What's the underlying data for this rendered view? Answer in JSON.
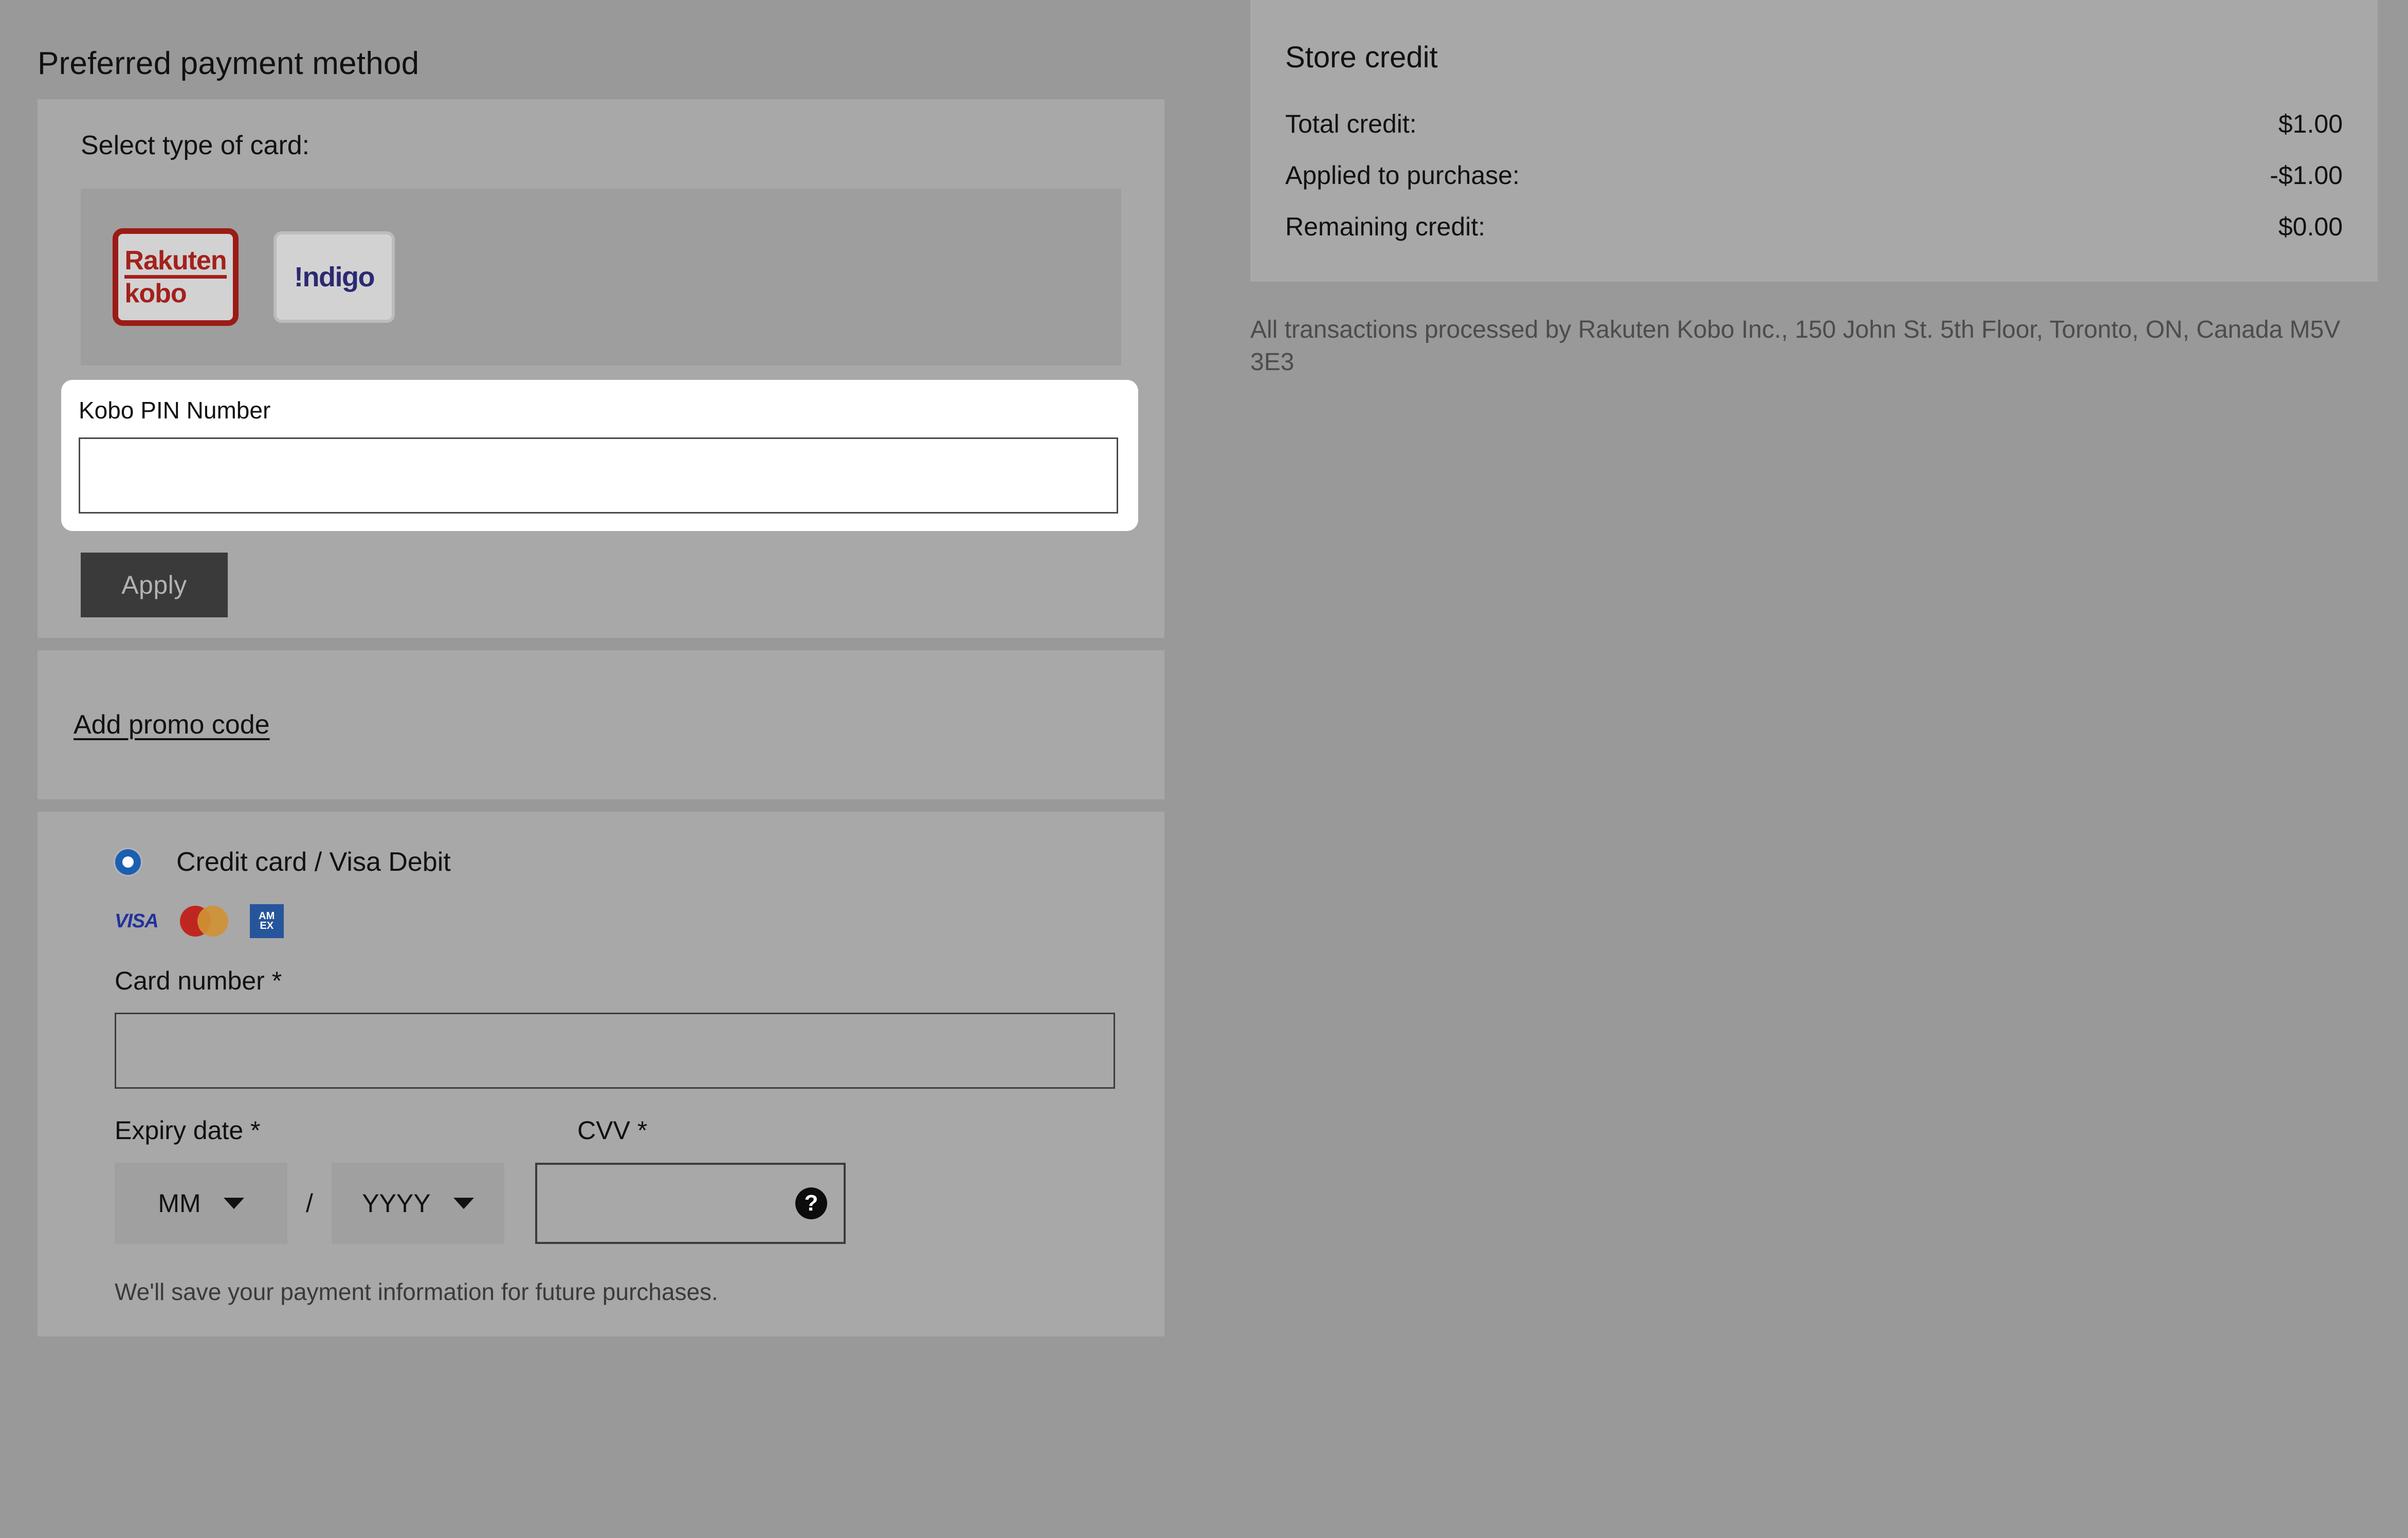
{
  "left": {
    "heading": "Preferred payment method",
    "card_type": {
      "subhead": "Select type of card:",
      "options": [
        {
          "name": "rakuten-kobo",
          "line1": "Rakuten",
          "line2": "kobo",
          "selected": true
        },
        {
          "name": "indigo",
          "label": "!ndigo",
          "selected": false
        }
      ]
    },
    "pin": {
      "label": "Kobo PIN Number",
      "value": "",
      "placeholder": ""
    },
    "apply_label": "Apply",
    "promo_link": "Add promo code",
    "credit_card": {
      "radio_label": "Credit card / Visa Debit",
      "brands": [
        "VISA",
        "mastercard",
        "AMERICAN EXPRESS"
      ],
      "amex_line1": "AM",
      "amex_line2": "EX",
      "visa_text": "VISA",
      "card_number_label": "Card number *",
      "card_number_value": "",
      "expiry_label": "Expiry date *",
      "cvv_label": "CVV *",
      "month_value": "MM",
      "year_value": "YYYY",
      "separator": "/",
      "cvv_value": "",
      "help_glyph": "?",
      "save_note": "We'll save your payment information for future purchases."
    }
  },
  "right": {
    "store_credit": {
      "title": "Store credit",
      "rows": [
        {
          "label": "Total credit:",
          "value": "$1.00"
        },
        {
          "label": "Applied to purchase:",
          "value": "-$1.00"
        },
        {
          "label": "Remaining credit:",
          "value": "$0.00"
        }
      ]
    },
    "disclaimer": "All transactions processed by Rakuten Kobo Inc., 150 John St. 5th Floor, Toronto, ON, Canada M5V 3E3"
  },
  "colors": {
    "page_bg": "#999999",
    "panel_bg": "#a8a8a8",
    "selected_border": "#9b1b16",
    "kobo_red": "#a4201c",
    "indigo_blue": "#2b2a72",
    "radio_blue": "#1b5fb3",
    "apply_bg": "#3a3a3a",
    "visa_blue": "#23319c",
    "amex_blue": "#26559b"
  }
}
